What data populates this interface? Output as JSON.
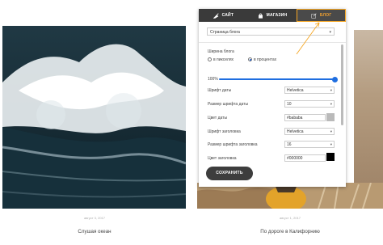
{
  "panel": {
    "tabs": [
      {
        "label": "САЙТ",
        "icon": "brush-icon"
      },
      {
        "label": "МАГАЗИН",
        "icon": "bag-icon"
      },
      {
        "label": "БЛОГ",
        "icon": "edit-icon"
      }
    ],
    "active_tab": 2,
    "page_select": {
      "value": "Страница блога"
    },
    "blog_width": {
      "label": "Ширина блога",
      "options": [
        "в пикселях",
        "в процентах"
      ],
      "selected": 1,
      "value_text": "100%",
      "value": 100
    },
    "settings": [
      {
        "label": "Шрифт даты",
        "type": "dropdown",
        "value": "Helvetica"
      },
      {
        "label": "Размер шрифта даты",
        "type": "dropdown",
        "value": "10"
      },
      {
        "label": "Цвет даты",
        "type": "color",
        "value": "#bababa",
        "color": "#bababa"
      },
      {
        "label": "Шрифт заголовка",
        "type": "dropdown",
        "value": "Helvetica"
      },
      {
        "label": "Размер шрифта заголовка",
        "type": "dropdown",
        "value": "16"
      },
      {
        "label": "Цвет заголовка",
        "type": "color",
        "value": "#000000",
        "color": "#000000"
      }
    ],
    "save_label": "СОХРАНИТЬ"
  },
  "posts": [
    {
      "date": "август 3, 2017",
      "title": "Слушая океан"
    },
    {
      "date": "август 1, 2017",
      "title": "По дороге в Калифорнию"
    }
  ],
  "colors": {
    "accent": "#f5a623",
    "slider": "#1f6ee0",
    "tab_bar": "#3a3a3a",
    "button": "#3d3d3d"
  }
}
